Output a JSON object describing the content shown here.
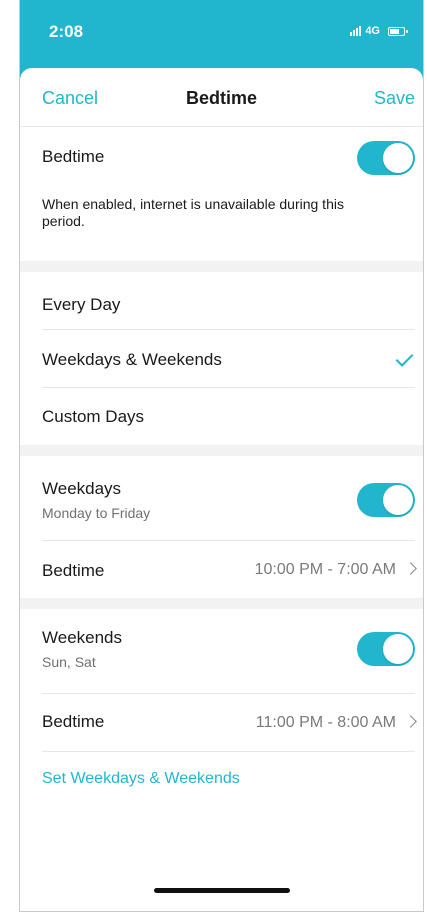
{
  "status_bar": {
    "time": "2:08",
    "network": "4G"
  },
  "nav": {
    "cancel_label": "Cancel",
    "title": "Bedtime",
    "save_label": "Save"
  },
  "bedtime_toggle": {
    "label": "Bedtime",
    "enabled": true,
    "description": "When enabled, internet is unavailable during this period."
  },
  "schedule_options": [
    {
      "label": "Every Day",
      "selected": false
    },
    {
      "label": "Weekdays & Weekends",
      "selected": true
    },
    {
      "label": "Custom Days",
      "selected": false
    }
  ],
  "weekdays": {
    "label": "Weekdays",
    "sublabel": "Monday to Friday",
    "enabled": true,
    "bedtime_label": "Bedtime",
    "bedtime_value": "10:00 PM - 7:00 AM"
  },
  "weekends": {
    "label": "Weekends",
    "sublabel": "Sun, Sat",
    "enabled": true,
    "bedtime_label": "Bedtime",
    "bedtime_value": "11:00 PM - 8:00 AM"
  },
  "set_link_label": "Set Weekdays & Weekends",
  "colors": {
    "accent": "#21b6cd"
  }
}
